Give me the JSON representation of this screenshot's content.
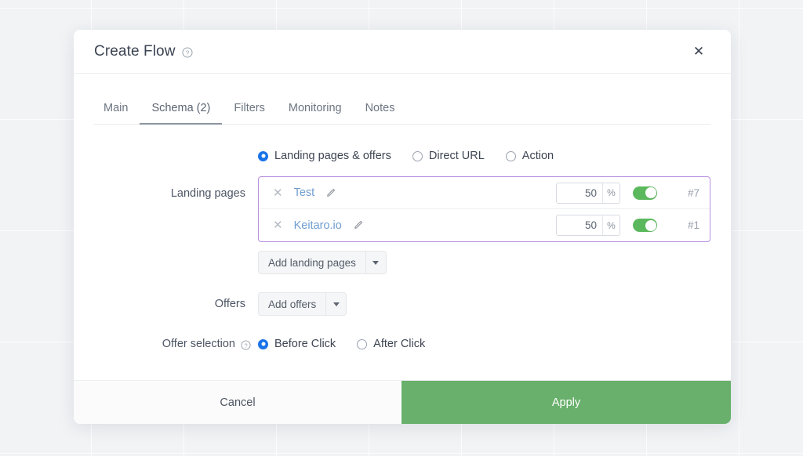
{
  "modal": {
    "title": "Create Flow",
    "title_help_icon": "question-circle-icon",
    "close_icon": "close-icon",
    "tabs": [
      {
        "label": "Main",
        "active": false
      },
      {
        "label": "Schema (2)",
        "active": true
      },
      {
        "label": "Filters",
        "active": false
      },
      {
        "label": "Monitoring",
        "active": false
      },
      {
        "label": "Notes",
        "active": false
      }
    ],
    "schema_type": {
      "options": [
        {
          "label": "Landing pages & offers",
          "checked": true
        },
        {
          "label": "Direct URL",
          "checked": false
        },
        {
          "label": "Action",
          "checked": false
        }
      ]
    },
    "landing_pages": {
      "label": "Landing pages",
      "border_color": "#b98fe0",
      "items": [
        {
          "remove_icon": "close-icon",
          "name": "Test",
          "edit_icon": "pencil-icon",
          "weight": "50",
          "unit": "%",
          "enabled": true,
          "id": "#7"
        },
        {
          "remove_icon": "close-icon",
          "name": "Keitaro.io",
          "edit_icon": "pencil-icon",
          "weight": "50",
          "unit": "%",
          "enabled": true,
          "id": "#1"
        }
      ],
      "add_button": {
        "label": "Add landing pages",
        "caret_icon": "chevron-down-icon"
      }
    },
    "offers": {
      "label": "Offers",
      "add_button": {
        "label": "Add offers",
        "caret_icon": "chevron-down-icon"
      }
    },
    "offer_selection": {
      "label": "Offer selection",
      "help_icon": "question-circle-icon",
      "options": [
        {
          "label": "Before Click",
          "checked": true
        },
        {
          "label": "After Click",
          "checked": false
        }
      ]
    },
    "footer": {
      "cancel_label": "Cancel",
      "apply_label": "Apply",
      "apply_color": "#68b06b"
    }
  }
}
